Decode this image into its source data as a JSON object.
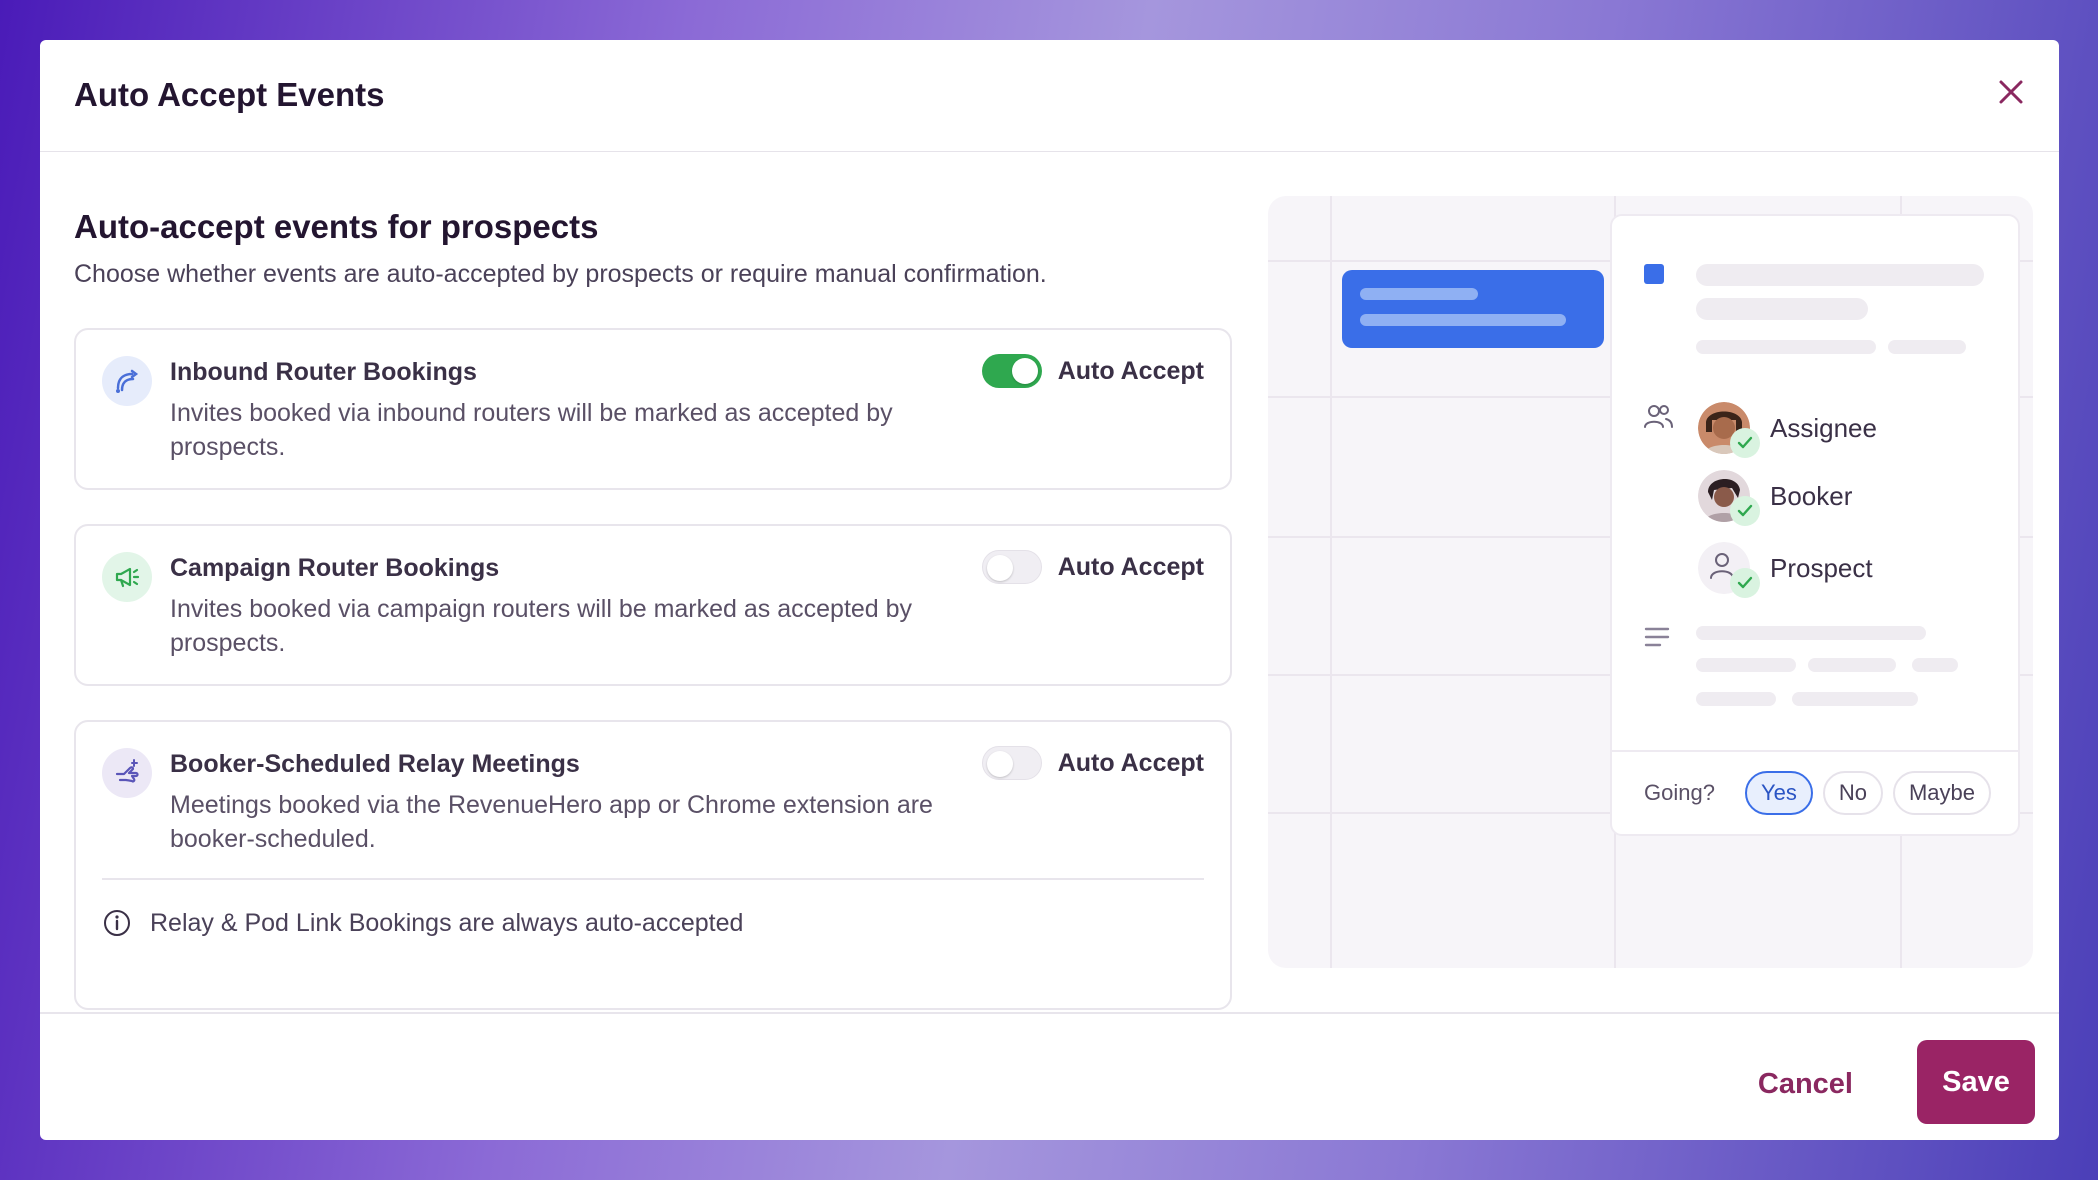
{
  "modal": {
    "title": "Auto Accept Events"
  },
  "section": {
    "title": "Auto-accept events for prospects",
    "description": "Choose whether events are auto-accepted by prospects or require manual confirmation."
  },
  "cards": [
    {
      "title": "Inbound Router Bookings",
      "description": "Invites booked via inbound routers will be marked as accepted by prospects.",
      "toggle_label": "Auto Accept",
      "enabled": true
    },
    {
      "title": "Campaign Router Bookings",
      "description": "Invites booked via campaign routers will be marked as accepted by prospects.",
      "toggle_label": "Auto Accept",
      "enabled": false
    },
    {
      "title": "Booker-Scheduled Relay Meetings",
      "description": "Meetings booked via the RevenueHero app or Chrome extension are booker-scheduled.",
      "toggle_label": "Auto Accept",
      "enabled": false,
      "info": "Relay & Pod Link Bookings are always auto-accepted"
    }
  ],
  "preview": {
    "people": [
      "Assignee",
      "Booker",
      "Prospect"
    ],
    "going_label": "Going?",
    "rsvp_options": [
      "Yes",
      "No",
      "Maybe"
    ],
    "rsvp_selected": "Yes"
  },
  "footer": {
    "cancel_label": "Cancel",
    "save_label": "Save"
  },
  "colors": {
    "accent": "#9a2465",
    "toggle_on": "#2fa84f",
    "event_blue": "#3a6ee8"
  }
}
